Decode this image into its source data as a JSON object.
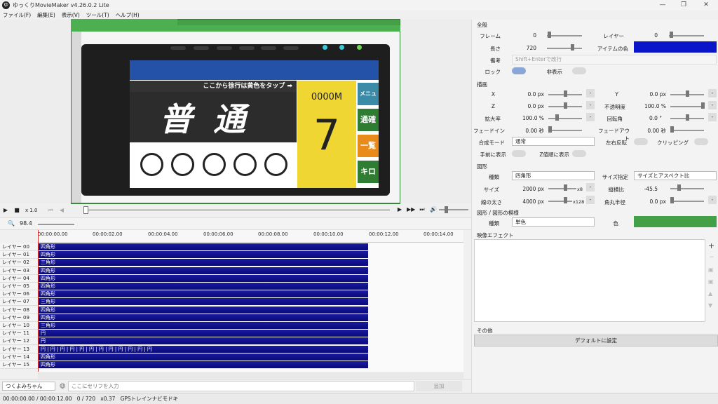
{
  "titlebar": {
    "title": "ゆっくりMovieMaker v4.26.0.2 Lite",
    "icon_text": "ゆ"
  },
  "window_controls": {
    "minimize": "—",
    "restore": "❐",
    "close": "✕"
  },
  "menu": [
    "ファイル(F)",
    "編集(E)",
    "表示(V)",
    "ツール(T)",
    "ヘルプ(H)"
  ],
  "preview": {
    "hint": "ここから徐行は黄色をタップ ➡",
    "main_label": "普通",
    "distance": "0000M",
    "big_number": "7",
    "side_buttons": [
      "メニュー",
      "通確",
      "一覧",
      "キロ"
    ],
    "side_colors": [
      "#3b8aa8",
      "#2e7d32",
      "#e88b1a",
      "#2e7d32"
    ]
  },
  "transport": {
    "speed": "x 1.0"
  },
  "timeline": {
    "zoom": "98.4",
    "ticks": [
      "00:00:00.00",
      "00:00:02.00",
      "00:00:04.00",
      "00:00:06.00",
      "00:00:08.00",
      "00:00:10.00",
      "00:00:12.00",
      "00:00:14.00"
    ],
    "layers": [
      {
        "name": "レイヤー 00",
        "clip": "四角形"
      },
      {
        "name": "レイヤー 01",
        "clip": "四角形"
      },
      {
        "name": "レイヤー 02",
        "clip": "三角形"
      },
      {
        "name": "レイヤー 03",
        "clip": "四角形"
      },
      {
        "name": "レイヤー 04",
        "clip": "四角形"
      },
      {
        "name": "レイヤー 05",
        "clip": "四角形"
      },
      {
        "name": "レイヤー 06",
        "clip": "四角形"
      },
      {
        "name": "レイヤー 07",
        "clip": "三角形"
      },
      {
        "name": "レイヤー 08",
        "clip": "四角形"
      },
      {
        "name": "レイヤー 09",
        "clip": "四角形"
      },
      {
        "name": "レイヤー 10",
        "clip": "三角形"
      },
      {
        "name": "レイヤー 11",
        "clip": "円"
      },
      {
        "name": "レイヤー 12",
        "clip": "円"
      },
      {
        "name": "レイヤー 13",
        "clip": "円 | 円 | 円 | 円 | 円 | 円 | 円 | 円 | 円 | 円 | 円 | 円"
      },
      {
        "name": "レイヤー 14",
        "clip": "四角形"
      },
      {
        "name": "レイヤー 15",
        "clip": "四角形"
      }
    ]
  },
  "speaker": {
    "name": "つくよみちゃん",
    "placeholder": "ここにセリフを入力",
    "add": "追加"
  },
  "status": {
    "time": "00:00:00.00",
    "total": "/ 00:00:12.00",
    "frame": "0",
    "frames": "/ 720",
    "rate": "x0.37",
    "name": "GPSトレインナビモドキ"
  },
  "panel": {
    "general": {
      "title": "全般",
      "frame_label": "フレーム",
      "frame_value": "0",
      "layer_label": "レイヤー",
      "layer_value": "0",
      "length_label": "長さ",
      "length_value": "720",
      "item_color_label": "アイテムの色",
      "item_color": "#0a14c8",
      "note_label": "備考",
      "note_placeholder": "Shift+Enterで改行",
      "lock_label": "ロック",
      "hide_label": "非表示"
    },
    "draw": {
      "title": "描画",
      "x_label": "X",
      "x_value": "0.0 px",
      "y_label": "Y",
      "y_value": "0.0 px",
      "z_label": "Z",
      "z_value": "0.0 px",
      "opacity_label": "不透明度",
      "opacity_value": "100.0 %",
      "scale_label": "拡大率",
      "scale_value": "100.0 %",
      "rotation_label": "回転角",
      "rotation_value": "0.0 °",
      "fadein_label": "フェードイン",
      "fadein_value": "0.00 秒",
      "fadeout_label": "フェードアウト",
      "fadeout_value": "0.00 秒",
      "blend_label": "合成モード",
      "blend_value": "通常",
      "flip_label": "左右反転",
      "clip_label": "クリッピング",
      "front_label": "手前に表示",
      "zorder_label": "Z値順に表示"
    },
    "shape": {
      "title": "図形",
      "kind_label": "種類",
      "kind_value": "四角形",
      "size_mode_label": "サイズ指定",
      "size_mode_value": "サイズとアスペクト比",
      "size_label": "サイズ",
      "size_value": "2000 px",
      "size_extra": "x8",
      "aspect_label": "縦横比",
      "aspect_value": "-45.5",
      "stroke_label": "線の太さ",
      "stroke_value": "4000 px",
      "stroke_extra": "x128",
      "radius_label": "角丸半径",
      "radius_value": "0.0 px"
    },
    "fill": {
      "title": "図形 / 図形の模様",
      "kind_label": "種類",
      "kind_value": "単色",
      "color_label": "色",
      "color": "#43a047"
    },
    "effects": {
      "title": "映像エフェクト"
    },
    "other": {
      "title": "その他",
      "default_button": "デフォルトに設定"
    }
  }
}
